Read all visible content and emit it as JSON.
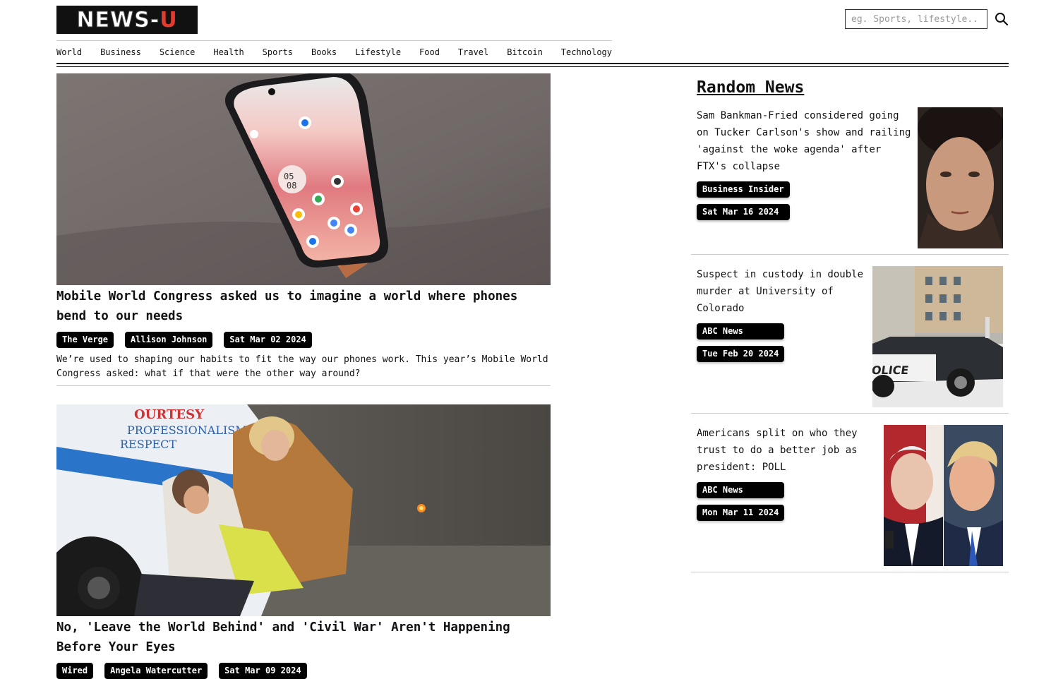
{
  "header": {
    "logo_part1": "NEWS-",
    "logo_part2": "U",
    "search_placeholder": "eg. Sports, lifestyle.."
  },
  "nav": [
    "World",
    "Business",
    "Science",
    "Health",
    "Sports",
    "Books",
    "Lifestyle",
    "Food",
    "Travel",
    "Bitcoin",
    "Technology"
  ],
  "articles": [
    {
      "title": "Mobile World Congress asked us to imagine a world where phones bend to our needs",
      "source": "The Verge",
      "author": "Allison Johnson",
      "date": "Sat Mar 02 2024",
      "description": "We’re used to shaping our habits to fit the way our phones work. This year’s Mobile World Congress asked: what if that were the other way around?"
    },
    {
      "title": "No, 'Leave the World Behind' and 'Civil War' Aren't Happening Before Your Eyes",
      "source": "Wired",
      "author": "Angela Watercutter",
      "date": "Sat Mar 09 2024"
    }
  ],
  "random_news": {
    "heading": "Random News",
    "items": [
      {
        "title": "Sam Bankman-Fried considered going on Tucker Carlson's show and railing 'against the woke agenda' after FTX's collapse",
        "source": "Business Insider",
        "date": "Sat Mar 16 2024"
      },
      {
        "title": "Suspect in custody in double murder at University of Colorado",
        "source": "ABC News",
        "date": "Tue Feb 20 2024"
      },
      {
        "title": "Americans split on who they trust to do a better job as president: POLL",
        "source": "ABC News",
        "date": "Mon Mar 11 2024"
      }
    ]
  },
  "colors": {
    "logo_accent": "#e23b2e",
    "badge_bg": "#000000"
  }
}
